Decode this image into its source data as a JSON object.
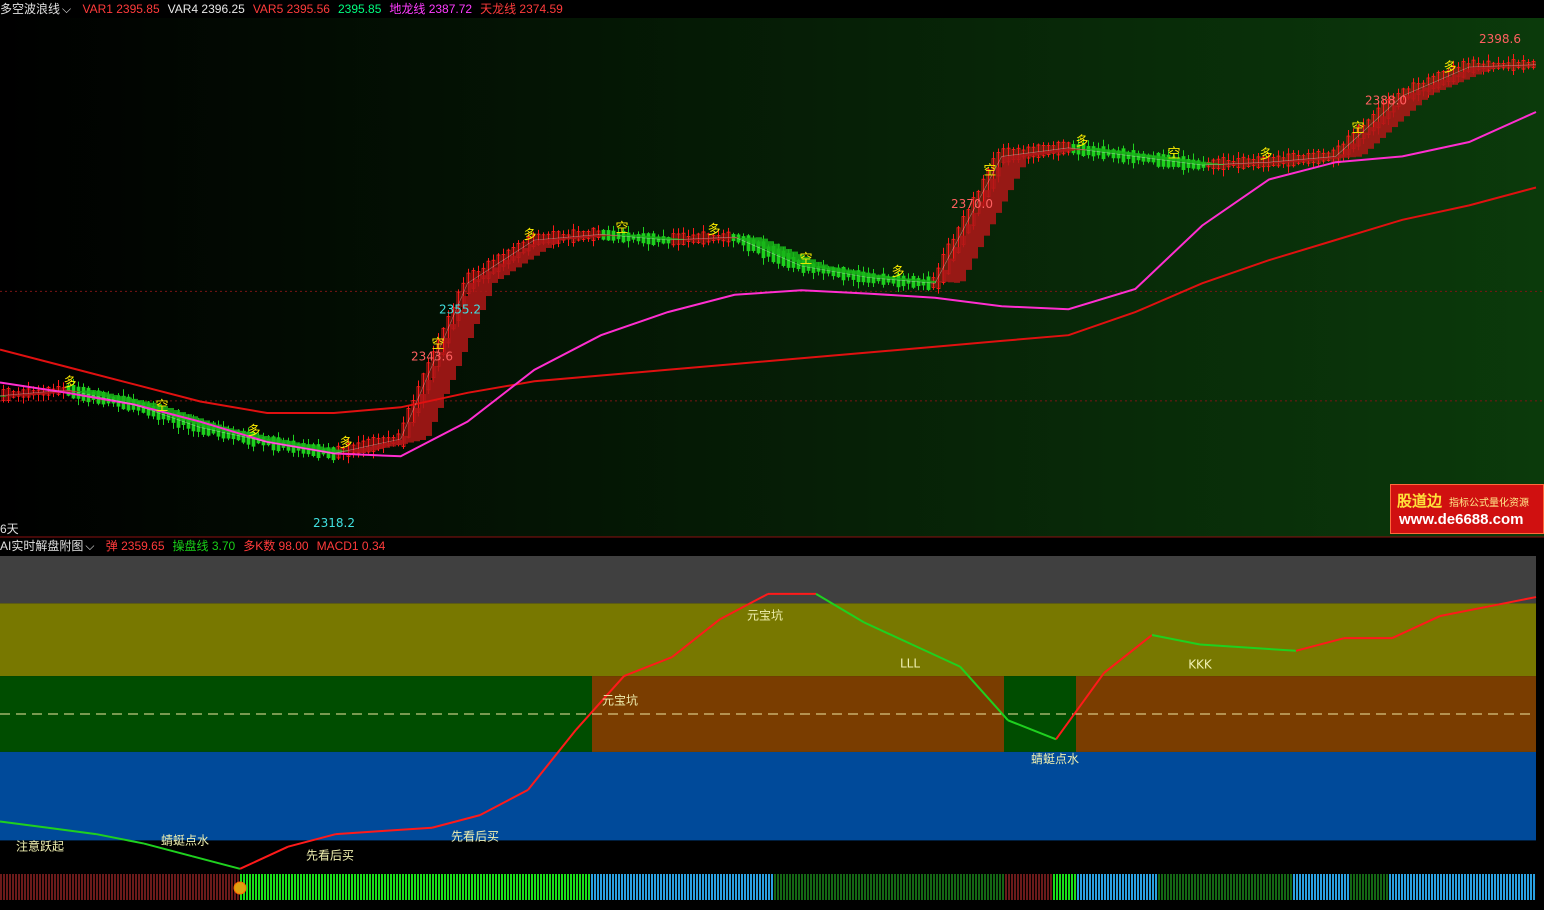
{
  "main_indicator": {
    "name": "多空波浪线",
    "items": [
      {
        "label": "VAR1",
        "value": "2395.85",
        "color": "#ff3b3b"
      },
      {
        "label": "VAR4",
        "value": "2396.25",
        "color": "#e8e8e8"
      },
      {
        "label": "VAR5",
        "value": "2395.56",
        "color": "#ff3b3b"
      },
      {
        "label": "",
        "value": "2395.85",
        "color": "#00ff7f"
      },
      {
        "label": "地龙线",
        "value": "2387.72",
        "color": "#ff3cff"
      },
      {
        "label": "天龙线",
        "value": "2374.59",
        "color": "#ff3b3b"
      }
    ]
  },
  "sub_indicator": {
    "name": "AI实时解盘附图",
    "items": [
      {
        "label": "弹",
        "value": "2359.65",
        "color": "#ff3b3b"
      },
      {
        "label": "操盘线",
        "value": "3.70",
        "color": "#18d018"
      },
      {
        "label": "多K数",
        "value": "98.00",
        "color": "#ff3b3b"
      },
      {
        "label": "MACD1",
        "value": "0.34",
        "color": "#ff3b3b"
      }
    ]
  },
  "watermark": {
    "brand": "股道边",
    "tagline": "指标公式量化资源",
    "url": "www.de6688.com"
  },
  "period_label": "6天",
  "colors": {
    "bull": "#ff1a1a",
    "bear": "#1fd11f",
    "ma_pink": "#ff2ed0",
    "ma_red": "#e01010",
    "label_red": "#ff6060",
    "label_cyan": "#40e0e0",
    "marker_text": "#ffee00",
    "band_gray": "#404040",
    "band_olive": "#787800",
    "band_green": "#004d00",
    "band_brown": "#7a3d00",
    "band_maroon": "#5a0a0a",
    "band_blue": "#004a9a"
  },
  "chart_data": [
    {
      "type": "candlestick",
      "title": "多空波浪线",
      "price_range": [
        2314,
        2404
      ],
      "price_labels": [
        {
          "text": "2343.6",
          "value": 2343.6,
          "kind": "high"
        },
        {
          "text": "2318.2",
          "value": 2318.2,
          "kind": "low"
        },
        {
          "text": "2370.0",
          "value": 2370.0,
          "kind": "high"
        },
        {
          "text": "2355.2",
          "value": 2355.2,
          "kind": "low"
        },
        {
          "text": "2388.0",
          "value": 2388.0,
          "kind": "high"
        },
        {
          "text": "2398.6",
          "value": 2398.6,
          "kind": "high"
        }
      ],
      "reference_lines": [
        2356.6,
        2337.6
      ],
      "series": [
        {
          "name": "地龙线",
          "values": [
            2340.8,
            2339.0,
            2337.0,
            2334.0,
            2330.5,
            2328.5,
            2328.0,
            2334.0,
            2343.0,
            2349.0,
            2353.0,
            2356.0,
            2356.8,
            2356.2,
            2355.5,
            2354.0,
            2353.5,
            2357.0,
            2368.0,
            2376.0,
            2379.0,
            2380.0,
            2382.5,
            2387.7
          ]
        },
        {
          "name": "天龙线",
          "values": [
            2346.5,
            2343.5,
            2340.5,
            2337.5,
            2335.5,
            2335.5,
            2336.5,
            2339.0,
            2341.0,
            2342.0,
            2343.0,
            2344.0,
            2345.0,
            2346.0,
            2347.0,
            2348.0,
            2349.0,
            2353.0,
            2358.0,
            2362.0,
            2365.5,
            2369.0,
            2371.5,
            2374.6
          ]
        },
        {
          "name": "多空波浪线",
          "values": [
            2338.5,
            2339.5,
            2337.0,
            2333.0,
            2330.5,
            2328.5,
            2331.0,
            2358.0,
            2365.5,
            2366.5,
            2365.5,
            2366.0,
            2361.0,
            2359.0,
            2358.0,
            2380.0,
            2381.5,
            2380.0,
            2378.5,
            2379.0,
            2380.0,
            2390.5,
            2395.5,
            2395.9
          ]
        }
      ],
      "signals": [
        {
          "text": "多"
        },
        {
          "text": "空"
        },
        {
          "text": "多"
        },
        {
          "text": "多"
        },
        {
          "text": "空"
        },
        {
          "text": "多"
        },
        {
          "text": "空"
        },
        {
          "text": "多"
        },
        {
          "text": "空"
        },
        {
          "text": "多"
        },
        {
          "text": "空"
        },
        {
          "text": "多"
        },
        {
          "text": "空"
        },
        {
          "text": "多"
        },
        {
          "text": "空"
        },
        {
          "text": "多"
        }
      ]
    },
    {
      "type": "line",
      "title": "AI实时解盘附图",
      "value_range": [
        0,
        100
      ],
      "zones": [
        {
          "from": 85,
          "to": 100,
          "color": "#404040"
        },
        {
          "from": 62,
          "to": 85,
          "color": "#787800"
        },
        {
          "from": 38,
          "to": 62,
          "color": "#004d00"
        },
        {
          "from": 10,
          "to": 38,
          "color": "#004a9a"
        }
      ],
      "threshold": 50,
      "series": [
        {
          "values": [
            16,
            14,
            12,
            9,
            5,
            1,
            8,
            12,
            13,
            14,
            18,
            26,
            45,
            62,
            68,
            80,
            88,
            88,
            79,
            72,
            65,
            48,
            42,
            63,
            75,
            72,
            71,
            70,
            74,
            74,
            81,
            84,
            87
          ]
        }
      ],
      "annotations": [
        {
          "text": "注意跃起"
        },
        {
          "text": "蜻蜓点水"
        },
        {
          "text": "先看后买"
        },
        {
          "text": "先看后买"
        },
        {
          "text": "元宝坑"
        },
        {
          "text": "元宝坑"
        },
        {
          "text": "LLL"
        },
        {
          "text": "蜻蜓点水"
        },
        {
          "text": "KKK"
        }
      ]
    }
  ]
}
